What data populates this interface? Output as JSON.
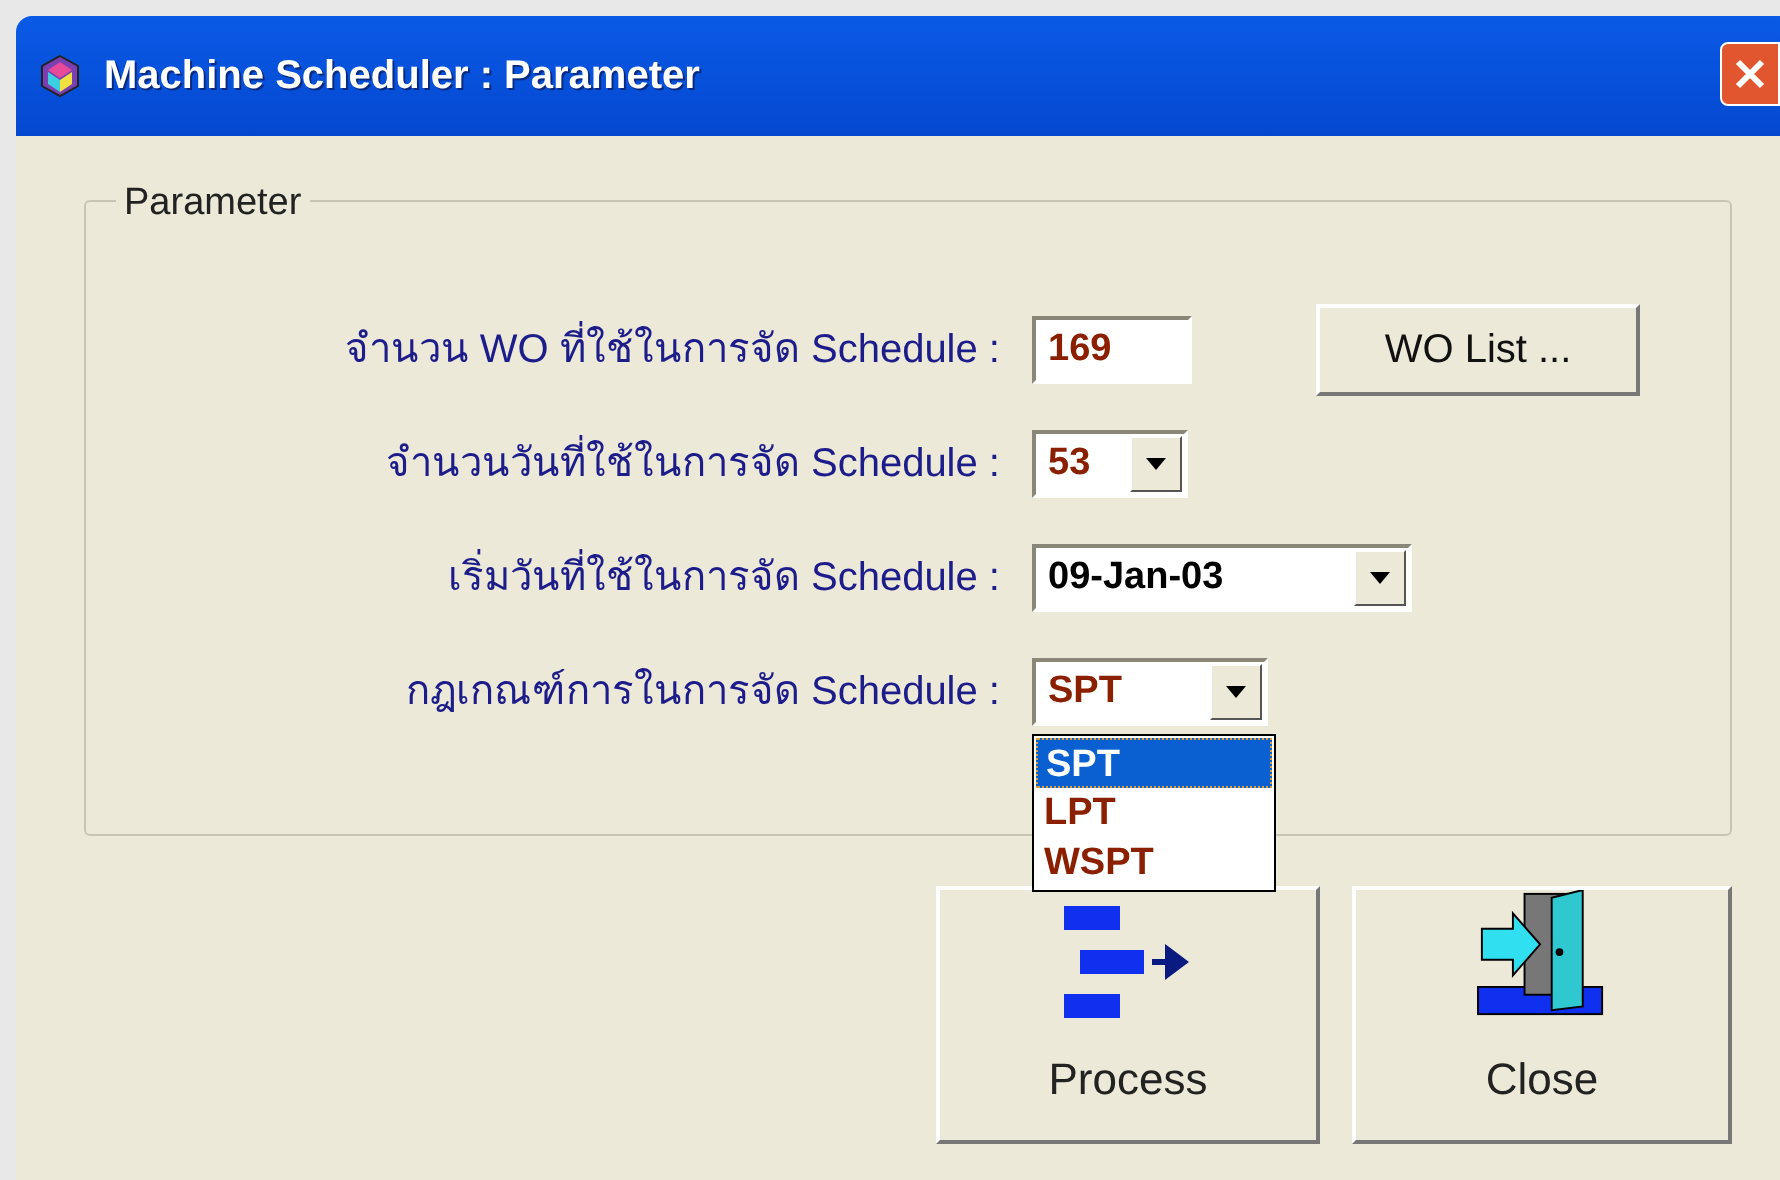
{
  "window": {
    "title": "Machine Scheduler : Parameter"
  },
  "group": {
    "legend": "Parameter"
  },
  "fields": [
    {
      "kind": "text",
      "label": "จำนวน WO ที่ใช้ในการจัด Schedule :",
      "value": "169"
    },
    {
      "kind": "combo",
      "label": "จำนวนวันที่ใช้ในการจัด Schedule :",
      "value": "53"
    },
    {
      "kind": "combo",
      "label": "เริ่มวันที่ใช้ในการจัด Schedule :",
      "value": "09-Jan-03"
    },
    {
      "kind": "combo",
      "label": "กฎเกณฑ์การในการจัด Schedule :",
      "value": "SPT",
      "expanded": true
    }
  ],
  "wo_list_button": "WO List ...",
  "dropdown_options": [
    {
      "label": "SPT",
      "selected": true
    },
    {
      "label": "LPT",
      "selected": false
    },
    {
      "label": "WSPT",
      "selected": false
    }
  ],
  "buttons": [
    {
      "kind": "process",
      "label": "Process"
    },
    {
      "kind": "close",
      "label": "Close"
    }
  ]
}
